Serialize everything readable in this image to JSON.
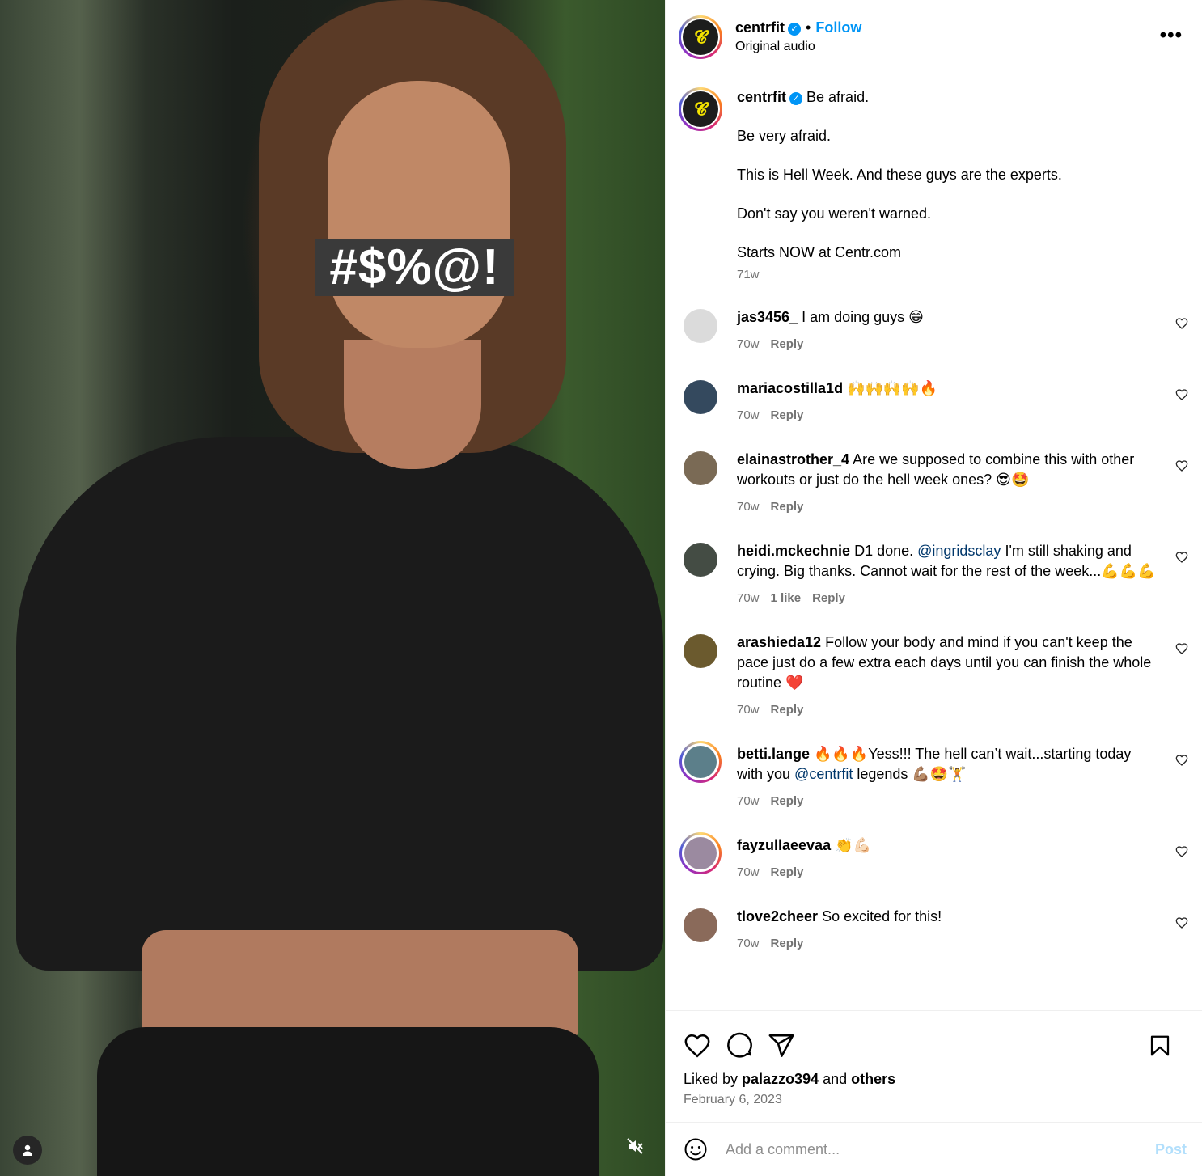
{
  "media": {
    "censor_text": "#$%@!"
  },
  "header": {
    "username": "centrfit",
    "separator": "•",
    "follow_label": "Follow",
    "audio": "Original audio",
    "more": "•••"
  },
  "caption": {
    "username": "centrfit",
    "lines": [
      "Be afraid.",
      "Be very afraid.",
      "This is Hell Week. And these guys are the experts.",
      "Don't say you weren't warned.",
      "Starts NOW at Centr.com"
    ],
    "time": "71w"
  },
  "comments": [
    {
      "user": "jas3456_",
      "text": " I am doing guys 😁",
      "time": "70w",
      "reply": "Reply",
      "avatar_color": "#dbdbdb"
    },
    {
      "user": "mariacostilla1d",
      "text": " 🙌🙌🙌🙌🔥",
      "time": "70w",
      "reply": "Reply",
      "avatar_color": "#34495e"
    },
    {
      "user": "elainastrother_4",
      "text": " Are we supposed to combine this with other workouts or just do the hell week ones? 😎🤩",
      "time": "70w",
      "reply": "Reply",
      "avatar_color": "#7a6a55"
    },
    {
      "user": "heidi.mckechnie",
      "text_a": " D1 done. ",
      "mention": "@ingridsclay",
      "text_b": " I'm still shaking and crying. Big thanks. Cannot wait for the rest of the week...💪💪💪",
      "time": "70w",
      "likes": "1 like",
      "reply": "Reply",
      "avatar_color": "#444c44"
    },
    {
      "user": "arashieda12",
      "text": " Follow your body and mind if you can't keep the pace just do a few extra each days until you can finish the whole routine ❤️",
      "time": "70w",
      "reply": "Reply",
      "avatar_color": "#6b5a2e"
    },
    {
      "user": "betti.lange",
      "text_a": " 🔥🔥🔥Yess!!! The hell can’t wait...starting today with you ",
      "mention": "@centrfit",
      "text_b": " legends 💪🏽🤩🏋️",
      "time": "70w",
      "reply": "Reply",
      "avatar_color": "#5c7f8a"
    },
    {
      "user": "fayzullaeevaa",
      "text": " 👏💪🏻",
      "time": "70w",
      "reply": "Reply",
      "avatar_color": "#9b8aa0"
    },
    {
      "user": "tlove2cheer",
      "text": " So excited for this!",
      "time": "70w",
      "reply": "Reply",
      "avatar_color": "#8a6a5a"
    }
  ],
  "likes": {
    "prefix": "Liked by ",
    "user": "palazzo394",
    "mid": " and ",
    "others": "others"
  },
  "date": "February 6, 2023",
  "add_comment": {
    "placeholder": "Add a comment...",
    "post_label": "Post"
  },
  "colors": {
    "accent": "#0095f6",
    "secondary_text": "#737373",
    "mention": "#00376b"
  },
  "icons": [
    "user-tag-icon",
    "mute-icon",
    "verified-icon",
    "more-icon",
    "heart-icon",
    "comment-icon",
    "share-icon",
    "bookmark-icon",
    "emoji-icon"
  ]
}
